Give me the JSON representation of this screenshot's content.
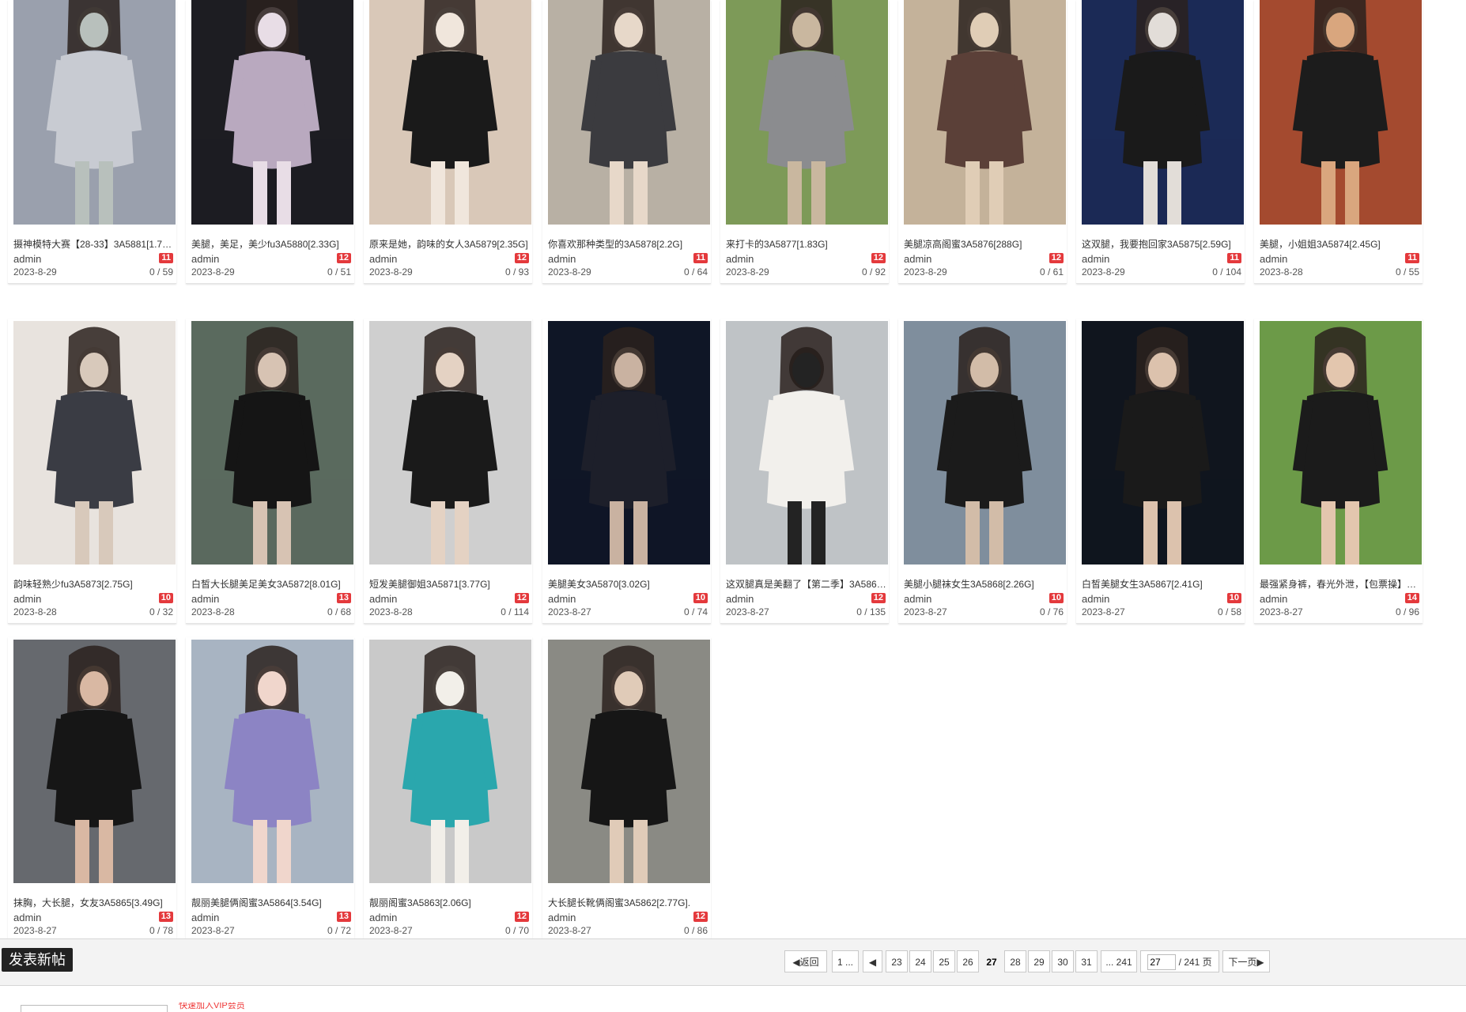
{
  "posts": [
    {
      "title": "摄神模特大赛【28-33】3A5881[1.7…",
      "author": "admin",
      "badge": "11",
      "date": "2023-8-29",
      "stats": "0 / 59",
      "palette": [
        "#9aa0ad",
        "#c8cbd2",
        "#b8c0bc"
      ]
    },
    {
      "title": "美腿，美足，美少fu3A5880[2.33G]",
      "author": "admin",
      "badge": "12",
      "date": "2023-8-29",
      "stats": "0 / 51",
      "palette": [
        "#1d1d22",
        "#b9a9bf",
        "#e8dde6"
      ]
    },
    {
      "title": "原来是她，韵味的女人3A5879[2.35G]",
      "author": "admin",
      "badge": "12",
      "date": "2023-8-29",
      "stats": "0 / 93",
      "palette": [
        "#d9c8b8",
        "#1a1a1a",
        "#f0e6dc"
      ]
    },
    {
      "title": "你喜欢那种类型的3A5878[2.2G]",
      "author": "admin",
      "badge": "11",
      "date": "2023-8-29",
      "stats": "0 / 64",
      "palette": [
        "#b8b0a4",
        "#3b3b3f",
        "#e7d8c9"
      ]
    },
    {
      "title": "来打卡的3A5877[1.83G]",
      "author": "admin",
      "badge": "12",
      "date": "2023-8-29",
      "stats": "0 / 92",
      "palette": [
        "#7d9a58",
        "#8b8c8f",
        "#c9b79f"
      ]
    },
    {
      "title": "美腿凉高阁蜜3A5876[288G]",
      "author": "admin",
      "badge": "12",
      "date": "2023-8-29",
      "stats": "0 / 61",
      "palette": [
        "#c4b29a",
        "#5b4038",
        "#e0cdb6"
      ]
    },
    {
      "title": "这双腿，我要抱回家3A5875[2.59G]",
      "author": "admin",
      "badge": "11",
      "date": "2023-8-29",
      "stats": "0 / 104",
      "palette": [
        "#1b2a56",
        "#1a1a1a",
        "#e2ddd8"
      ]
    },
    {
      "title": "美腿，小姐姐3A5874[2.45G]",
      "author": "admin",
      "badge": "11",
      "date": "2023-8-28",
      "stats": "0 / 55",
      "palette": [
        "#a44a2f",
        "#1c1c1c",
        "#d9a67e"
      ]
    },
    {
      "title": "韵味轻熟少fu3A5873[2.75G]",
      "author": "admin",
      "badge": "10",
      "date": "2023-8-28",
      "stats": "0 / 32",
      "palette": [
        "#e8e3de",
        "#3a3c44",
        "#d8c9bb"
      ]
    },
    {
      "title": "白皙大长腿美足美女3A5872[8.01G]",
      "author": "admin",
      "badge": "13",
      "date": "2023-8-28",
      "stats": "0 / 68",
      "palette": [
        "#5a6a5e",
        "#151515",
        "#d7c3b3"
      ]
    },
    {
      "title": "短发美腿御姐3A5871[3.77G]",
      "author": "admin",
      "badge": "12",
      "date": "2023-8-28",
      "stats": "0 / 114",
      "palette": [
        "#cfcfcf",
        "#1a1a1a",
        "#e4d2c3"
      ]
    },
    {
      "title": "美腿美女3A5870[3.02G]",
      "author": "admin",
      "badge": "10",
      "date": "2023-8-27",
      "stats": "0 / 74",
      "palette": [
        "#0f1626",
        "#1d1f2a",
        "#c9b2a1"
      ]
    },
    {
      "title": "这双腿真是美翻了【第二季】3A586…",
      "author": "admin",
      "badge": "12",
      "date": "2023-8-27",
      "stats": "0 / 135",
      "palette": [
        "#bfc3c6",
        "#f2f0ec",
        "#232323"
      ]
    },
    {
      "title": "美腿小腿袜女生3A5868[2.26G]",
      "author": "admin",
      "badge": "10",
      "date": "2023-8-27",
      "stats": "0 / 76",
      "palette": [
        "#7f8e9d",
        "#1b1b1b",
        "#d2bca8"
      ]
    },
    {
      "title": "白皙美腿女生3A5867[2.41G]",
      "author": "admin",
      "badge": "10",
      "date": "2023-8-27",
      "stats": "0 / 58",
      "palette": [
        "#10151e",
        "#1a1a1a",
        "#dcc2ad"
      ]
    },
    {
      "title": "最强紧身裤，春光外泄，【包票操】…",
      "author": "admin",
      "badge": "14",
      "date": "2023-8-27",
      "stats": "0 / 96",
      "palette": [
        "#6c9a48",
        "#1b1b1b",
        "#e3c6ae"
      ]
    },
    {
      "title": "抹胸，大长腿，女友3A5865[3.49G]",
      "author": "admin",
      "badge": "13",
      "date": "2023-8-27",
      "stats": "0 / 78",
      "palette": [
        "#66696e",
        "#161616",
        "#d9b8a3"
      ]
    },
    {
      "title": "靓丽美腿俩阁蜜3A5864[3.54G]",
      "author": "admin",
      "badge": "13",
      "date": "2023-8-27",
      "stats": "0 / 72",
      "palette": [
        "#a8b4c2",
        "#8c84c4",
        "#f0d6cc"
      ]
    },
    {
      "title": "靓丽阁蜜3A5863[2.06G]",
      "author": "admin",
      "badge": "12",
      "date": "2023-8-27",
      "stats": "0 / 70",
      "palette": [
        "#c9c9c9",
        "#2aa7ad",
        "#f2efe9"
      ]
    },
    {
      "title": "大长腿长靴俩阁蜜3A5862[2.77G].",
      "author": "admin",
      "badge": "12",
      "date": "2023-8-27",
      "stats": "0 / 86",
      "palette": [
        "#8a8a84",
        "#161616",
        "#e0cbb8"
      ]
    }
  ],
  "actions": {
    "new_post": "发表新帖"
  },
  "pagination": {
    "back": "返回",
    "first": "1 ...",
    "pages": [
      "23",
      "24",
      "25",
      "26",
      "27",
      "28",
      "29",
      "30",
      "31"
    ],
    "current": "27",
    "last": "... 241",
    "jump_value": "27",
    "total": "/ 241 页",
    "next": "下一页"
  },
  "footer": {
    "promo": "快速加入VIP会员"
  }
}
